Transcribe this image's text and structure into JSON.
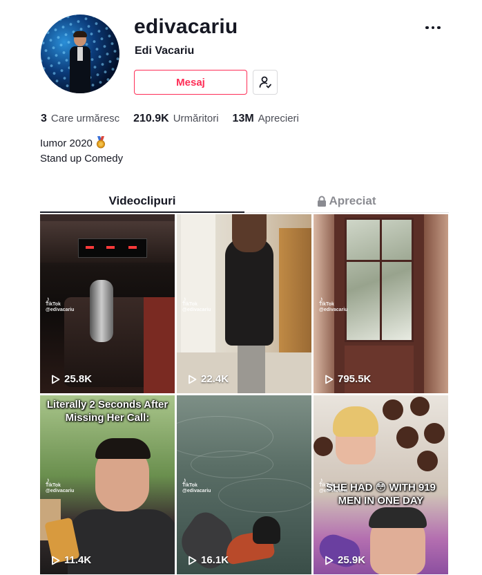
{
  "profile": {
    "username": "edivacariu",
    "nickname": "Edi Vacariu",
    "message_label": "Mesaj"
  },
  "stats": {
    "following": {
      "count": "3",
      "label": "Care urmăresc"
    },
    "followers": {
      "count": "210.9K",
      "label": "Urmăritori"
    },
    "likes": {
      "count": "13M",
      "label": "Aprecieri"
    }
  },
  "bio": {
    "line1": "Iumor 2020",
    "line2": "Stand up Comedy"
  },
  "tabs": {
    "videos": "Videoclipuri",
    "liked": "Apreciat"
  },
  "videos": [
    {
      "views": "25.8K"
    },
    {
      "views": "22.4K"
    },
    {
      "views": "795.5K"
    },
    {
      "views": "11.4K",
      "caption": "Literally 2 Seconds After Missing Her Call:"
    },
    {
      "views": "16.1K"
    },
    {
      "views": "25.9K",
      "caption": "SHE HAD 😳 WITH 919 MEN IN ONE DAY"
    }
  ],
  "watermark": {
    "brand": "TikTok",
    "handle": "@edivacariu"
  },
  "colors": {
    "accent": "#fe2c55",
    "text": "#161823",
    "muted": "#8a8b91"
  }
}
